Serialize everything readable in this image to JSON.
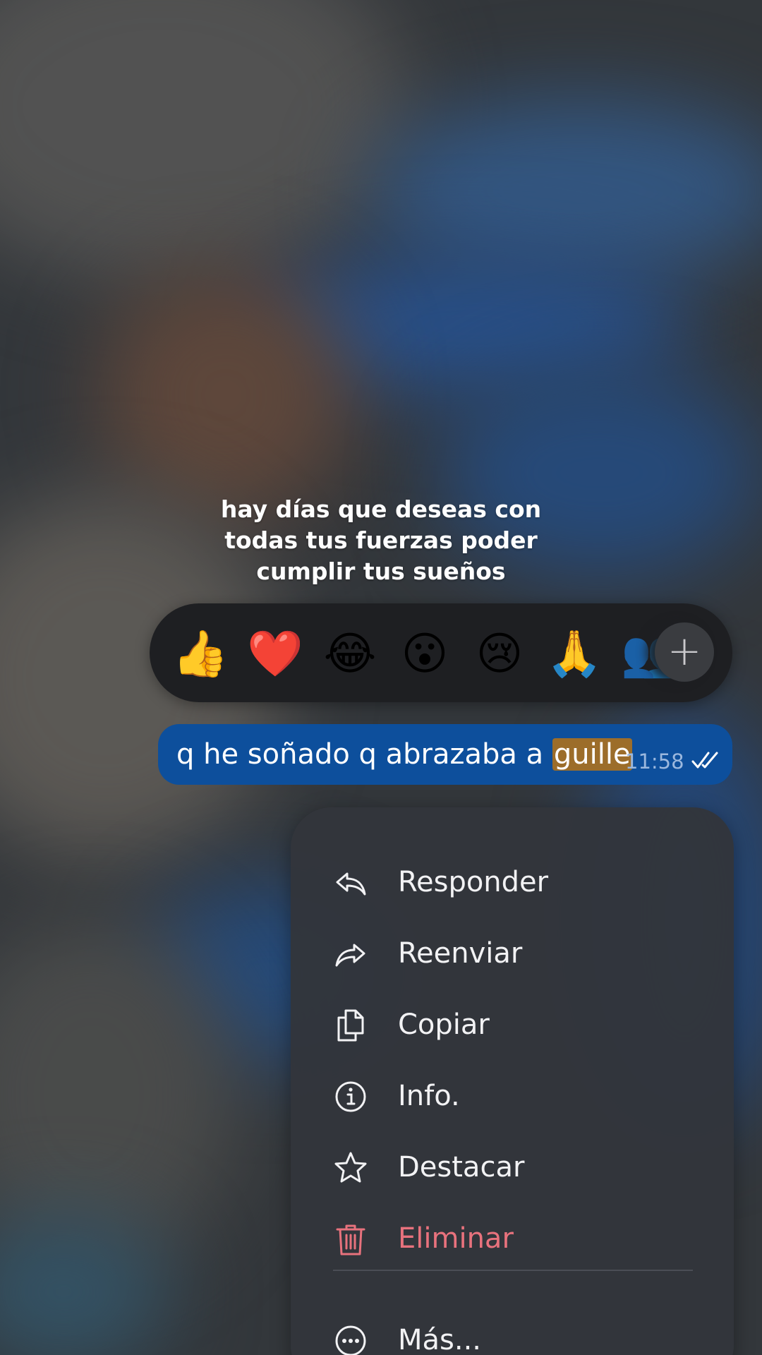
{
  "caption": {
    "line1": "hay días que deseas con",
    "line2": "todas tus fuerzas poder",
    "line3": "cumplir tus sueños"
  },
  "reactions": [
    {
      "icon": "thumbs-up-icon",
      "glyph": "👍"
    },
    {
      "icon": "heart-icon",
      "glyph": "❤️"
    },
    {
      "icon": "tears-of-joy-icon",
      "glyph": "😂"
    },
    {
      "icon": "surprised-face-icon",
      "glyph": "😮"
    },
    {
      "icon": "crying-face-icon",
      "glyph": "😢"
    },
    {
      "icon": "folded-hands-icon",
      "glyph": "🙏"
    },
    {
      "icon": "partial-emoji-icon",
      "glyph": "👥"
    }
  ],
  "reaction_more": {
    "icon": "plus-icon",
    "glyph": "+"
  },
  "message": {
    "text_before": "q he soñado q abrazaba a ",
    "highlighted": "guille",
    "time": "11:58",
    "status_icon": "double-check-icon",
    "bubble_color": "#0d4f9c",
    "highlight_color": "#9c6d2a"
  },
  "menu": {
    "items": [
      {
        "label": "Responder",
        "icon": "reply-icon"
      },
      {
        "label": "Reenviar",
        "icon": "forward-icon"
      },
      {
        "label": "Copiar",
        "icon": "copy-icon"
      },
      {
        "label": "Info.",
        "icon": "info-icon"
      },
      {
        "label": "Destacar",
        "icon": "star-icon"
      },
      {
        "label": "Eliminar",
        "icon": "trash-icon",
        "color": "#e8727d"
      },
      {
        "label": "Más...",
        "icon": "more-icon"
      }
    ]
  }
}
